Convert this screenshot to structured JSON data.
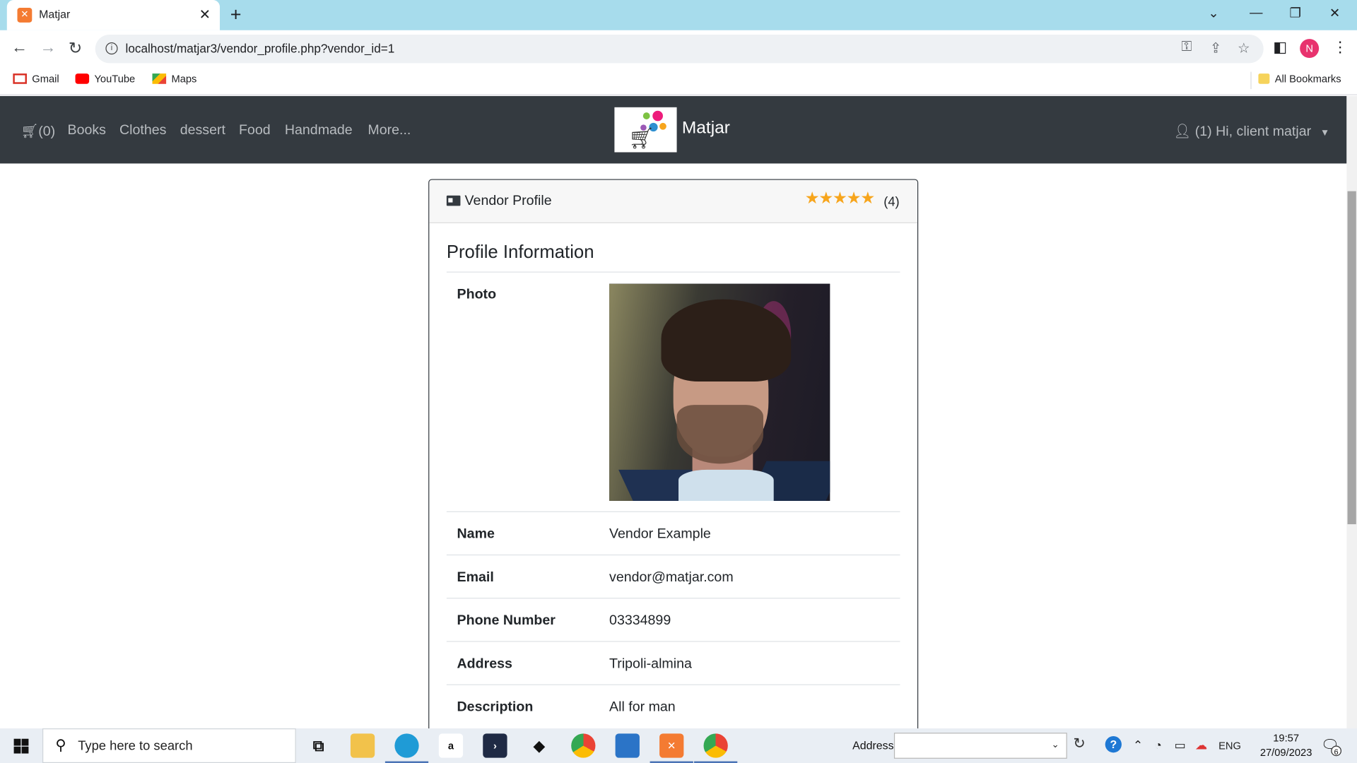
{
  "browser": {
    "tab_title": "Matjar",
    "tab_favicon": "xampp-icon",
    "url": "localhost/matjar3/vendor_profile.php?vendor_id=1",
    "profile_initial": "N",
    "bookmarks": [
      {
        "label": "Gmail",
        "icon": "gmail-icon"
      },
      {
        "label": "YouTube",
        "icon": "youtube-icon"
      },
      {
        "label": "Maps",
        "icon": "maps-icon"
      }
    ],
    "all_bookmarks": "All Bookmarks"
  },
  "navbar": {
    "cart": "(0)",
    "links": [
      "Books",
      "Clothes",
      "dessert",
      "Food",
      "Handmade",
      "More..."
    ],
    "brand": "Matjar",
    "user": "(1) Hi, client matjar"
  },
  "card": {
    "header_title": "Vendor Profile",
    "stars": "★★★★★",
    "rating_count": "(4)",
    "rating_value": 5,
    "section_title": "Profile Information",
    "rows": [
      {
        "label": "Photo",
        "value": ""
      },
      {
        "label": "Name",
        "value": "Vendor Example"
      },
      {
        "label": "Email",
        "value": "vendor@matjar.com"
      },
      {
        "label": "Phone Number",
        "value": "03334899"
      },
      {
        "label": "Address",
        "value": "Tripoli-almina"
      },
      {
        "label": "Description",
        "value": "All for man"
      }
    ]
  },
  "taskbar": {
    "search_placeholder": "Type here to search",
    "address_label": "Address",
    "language": "ENG",
    "time": "19:57",
    "date": "27/09/2023",
    "notification_count": "6"
  }
}
